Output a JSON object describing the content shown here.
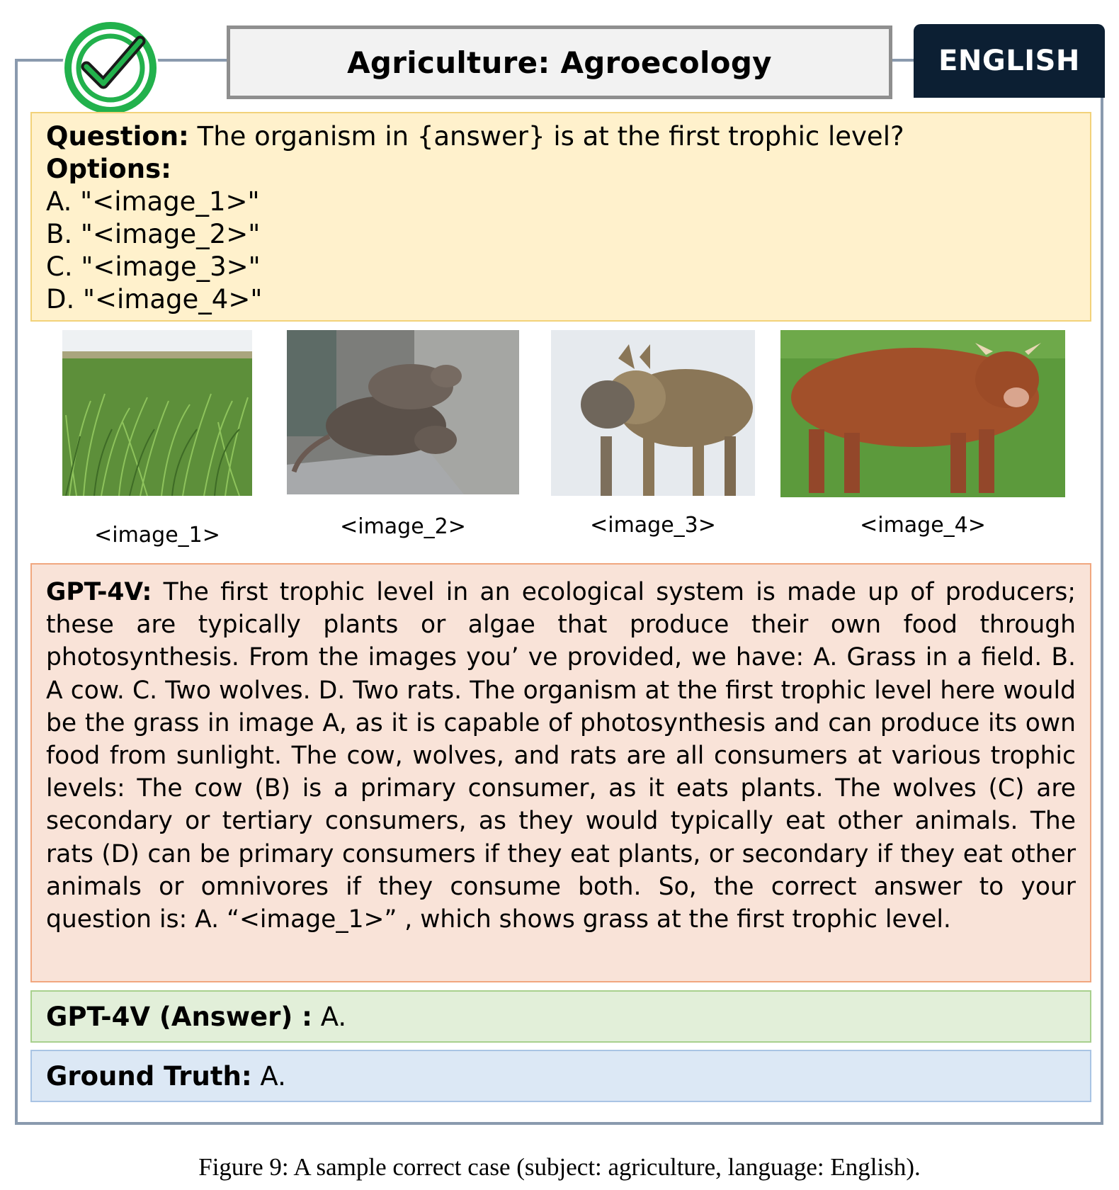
{
  "header": {
    "title": "Agriculture: Agroecology",
    "language": "ENGLISH",
    "status_icon": "check-circle-icon",
    "status_color": "#22b14c"
  },
  "question": {
    "label": "Question:",
    "text": " The organism in {answer} is at the first trophic level?",
    "options_label": "Options:",
    "options": [
      "A. \"<image_1>\"",
      "B. \"<image_2>\"",
      "C. \"<image_3>\"",
      "D. \"<image_4>\""
    ]
  },
  "images": [
    {
      "caption": "<image_1>",
      "subject": "grass field"
    },
    {
      "caption": "<image_2>",
      "subject": "rats"
    },
    {
      "caption": "<image_3>",
      "subject": "wolves"
    },
    {
      "caption": "<image_4>",
      "subject": "cow"
    }
  ],
  "response": {
    "label": "GPT-4V:",
    "text": " The first trophic level in an ecological system is made up of producers; these are typically plants or algae that produce their own food through photosynthesis. From the images you’ ve provided, we have: A. Grass in a field. B. A cow. C. Two wolves. D. Two rats. The organism at the first trophic level here would be the grass in image A, as it is capable of photosynthesis and can produce its own food from sunlight. The cow, wolves, and rats are all consumers at various trophic levels: The cow (B) is a primary consumer, as it eats plants. The wolves (C) are secondary or tertiary consumers, as they would typically eat other animals. The rats (D) can be primary consumers if they eat plants, or secondary if they eat other animals or omnivores if they consume both. So, the correct answer to your question is: A. “<image_1>” , which shows grass at the first trophic level."
  },
  "answer": {
    "label": "GPT-4V (Answer) :",
    "value": " A."
  },
  "ground_truth": {
    "label": "Ground Truth:",
    "value": " A."
  },
  "figure_caption": "Figure 9: A sample correct case (subject: agriculture, language: English)."
}
